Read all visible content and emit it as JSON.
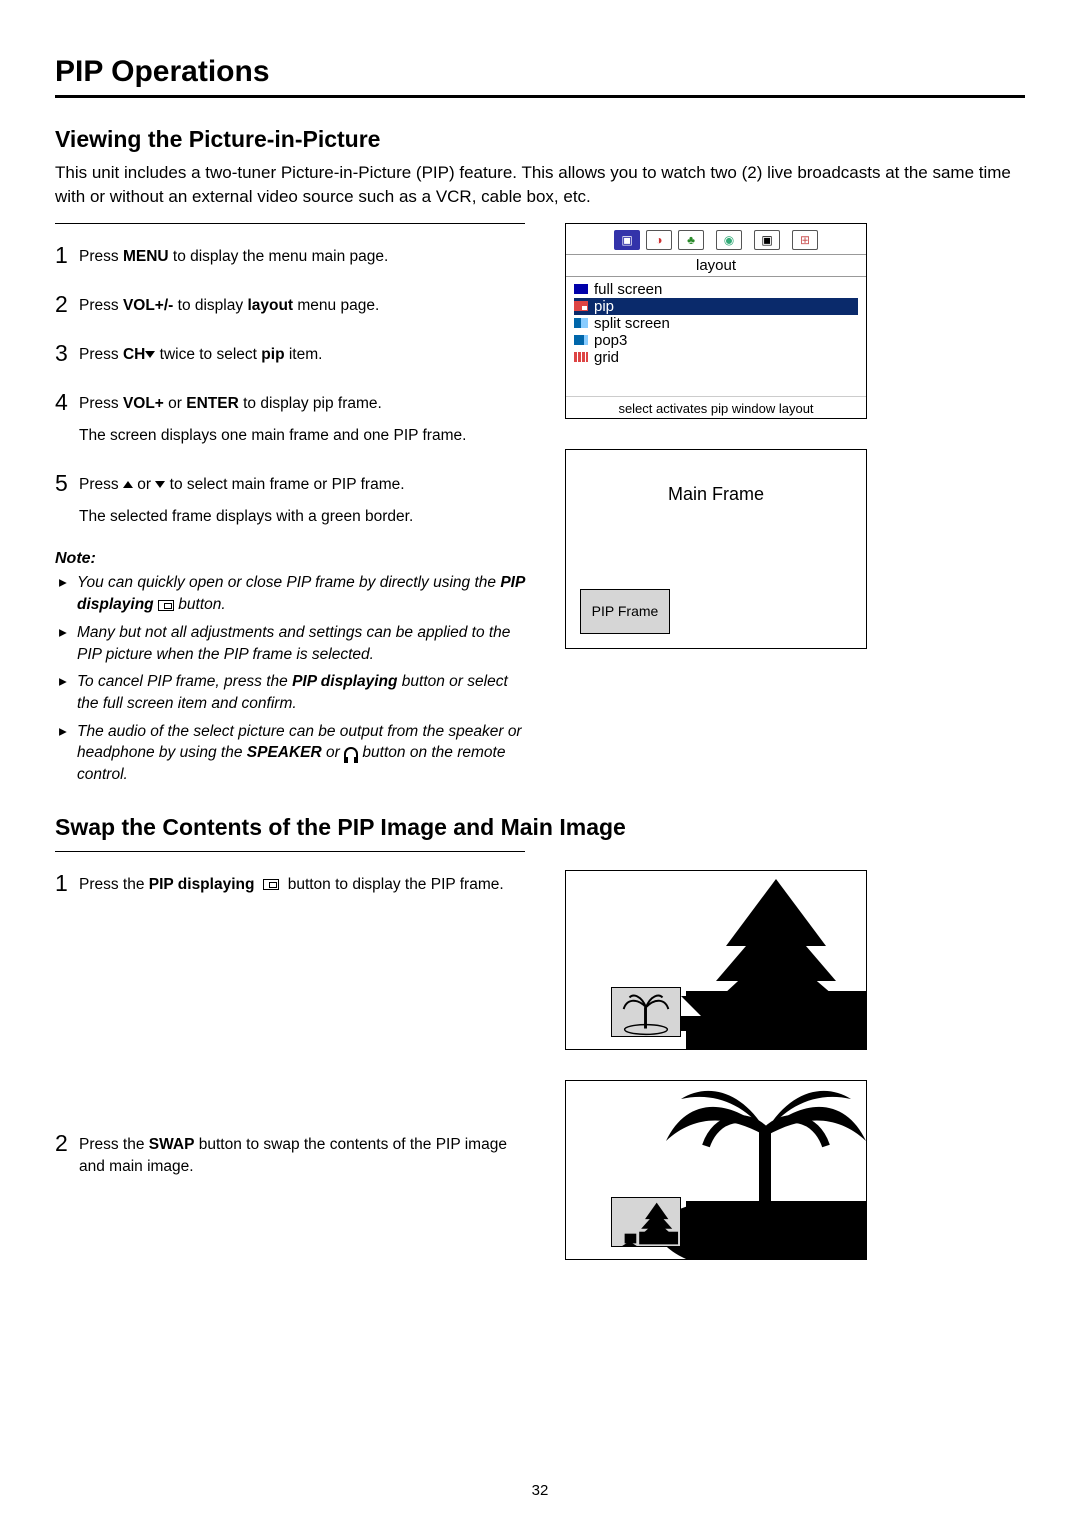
{
  "title": "PIP Operations",
  "section1": {
    "heading": "Viewing the Picture-in-Picture",
    "intro": "This unit includes a two-tuner Picture-in-Picture (PIP) feature. This allows you to watch two (2) live broadcasts at the same time with or without an external video source such as a VCR, cable box, etc."
  },
  "steps": [
    {
      "num": "1",
      "text_pre": "Press ",
      "bold1": "MENU",
      "text_post": " to display the menu main page."
    },
    {
      "num": "2",
      "text_pre": "Press ",
      "bold1": "VOL+/-",
      "text_mid": " to display ",
      "bold2": "layout",
      "text_post": " menu page."
    },
    {
      "num": "3",
      "text_pre": "Press ",
      "bold1": "CH",
      "text_mid": "",
      "arrowDown": true,
      "text_mid2": " twice to select ",
      "bold2": "pip",
      "text_post": " item."
    },
    {
      "num": "4",
      "text_pre": "Press ",
      "bold1": "VOL+",
      "text_mid": " or ",
      "bold2": "ENTER",
      "text_post": " to display pip frame.",
      "line2": "The screen displays one main frame and one PIP frame."
    },
    {
      "num": "5",
      "text_pre": "Press ",
      "arrowUp": true,
      "text_mid": " or ",
      "arrowDown": true,
      "text_post": " to select main frame or PIP frame.",
      "line2": "The selected frame displays with a green border."
    }
  ],
  "note": {
    "label": "Note:",
    "items": [
      {
        "pre": "You can quickly open or close PIP frame by directly using the ",
        "bold": "PIP displaying",
        "icon": "pip",
        "post": " button."
      },
      {
        "pre": "Many but not all adjustments and settings can be applied to the PIP picture when the PIP frame is selected."
      },
      {
        "pre": "To cancel PIP frame, press the ",
        "bold": "PIP displaying",
        "post": " button or select the full screen item and confirm."
      },
      {
        "pre": "The audio of the select picture can be output from the speaker or headphone by using the ",
        "bold": "SPEAKER",
        "mid": " or ",
        "icon": "headphone",
        "post": " button on the remote control."
      }
    ]
  },
  "section2": {
    "heading": "Swap the Contents of the PIP Image and Main Image"
  },
  "swapSteps": [
    {
      "num": "1",
      "pre": "Press the ",
      "bold": "PIP displaying",
      "icon": "pip",
      "post": " button to display the PIP frame."
    },
    {
      "num": "2",
      "pre": "Press the ",
      "bold": "SWAP",
      "post": " button to swap the contents of the PIP image and main image."
    }
  ],
  "osd": {
    "header": "layout",
    "items": [
      "full screen",
      "pip",
      "split screen",
      "pop3",
      "grid"
    ],
    "selectedIndex": 1,
    "footer": "select activates pip window layout"
  },
  "diagram": {
    "main": "Main Frame",
    "pip": "PIP Frame"
  },
  "pageNumber": "32"
}
